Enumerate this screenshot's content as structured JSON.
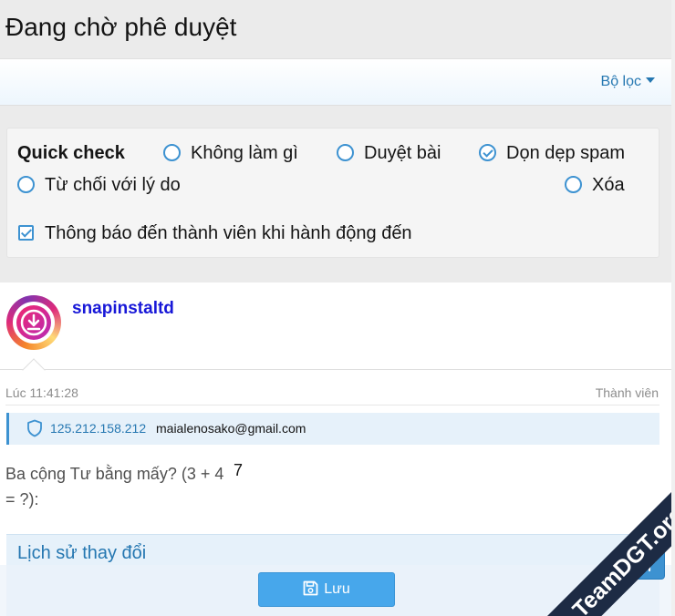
{
  "header": {
    "title": "Đang chờ phê duyệt"
  },
  "filter": {
    "label": "Bộ lọc"
  },
  "quick_check": {
    "title": "Quick check",
    "options": [
      {
        "label": "Không làm gì",
        "checked": false
      },
      {
        "label": "Duyệt bài",
        "checked": false
      },
      {
        "label": "Dọn dẹp spam",
        "checked": true
      },
      {
        "label": "Từ chối với lý do",
        "checked": false
      },
      {
        "label": "Xóa",
        "checked": false
      }
    ],
    "notify": {
      "label": "Thông báo đến thành viên khi hành động đến",
      "checked": true
    }
  },
  "user": {
    "name": "snapinstaltd",
    "time": "Lúc 11:41:28",
    "role": "Thành viên"
  },
  "ip": {
    "address": "125.212.158.212",
    "email": "maialenosako@gmail.com"
  },
  "captcha": {
    "question": "Ba cộng Tư bằng mấy? (3 + 4 = ?):",
    "answer": "7"
  },
  "history": {
    "title": "Lịch sử thay đổi"
  },
  "save": {
    "label": "Lưu"
  },
  "watermark": {
    "text": "TeamDGT.org"
  },
  "colors": {
    "accent": "#3d92d1",
    "link": "#2577b1",
    "username": "#1818d8",
    "button": "#47a7eb"
  }
}
